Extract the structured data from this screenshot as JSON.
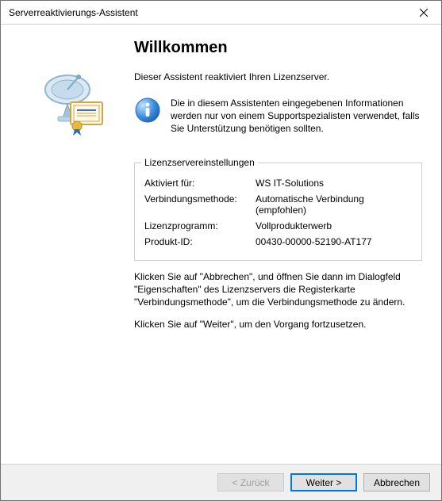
{
  "window": {
    "title": "Serverreaktivierungs-Assistent"
  },
  "main": {
    "heading": "Willkommen",
    "intro": "Dieser Assistent reaktiviert Ihren Lizenzserver.",
    "info_text": "Die in diesem Assistenten eingegebenen Informationen werden nur von einem Supportspezialisten verwendet, falls Sie Unterstützung benötigen sollten."
  },
  "groupbox": {
    "legend": "Lizenzservereinstellungen",
    "rows": {
      "activated_label": "Aktiviert für:",
      "activated_value": "WS IT-Solutions",
      "connmethod_label": "Verbindungsmethode:",
      "connmethod_value": "Automatische Verbindung (empfohlen)",
      "licprog_label": "Lizenzprogramm:",
      "licprog_value": "Vollprodukterwerb",
      "productid_label": "Produkt-ID:",
      "productid_value": "00430-00000-52190-AT177"
    }
  },
  "instructions": {
    "para1": "Klicken Sie auf \"Abbrechen\", und öffnen Sie dann im Dialogfeld \"Eigenschaften\" des Lizenzservers die Registerkarte \"Verbindungsmethode\", um die Verbindungsmethode zu ändern.",
    "para2": "Klicken Sie auf \"Weiter\", um den Vorgang fortzusetzen."
  },
  "buttons": {
    "back": "< Zurück",
    "next": "Weiter >",
    "cancel": "Abbrechen"
  }
}
